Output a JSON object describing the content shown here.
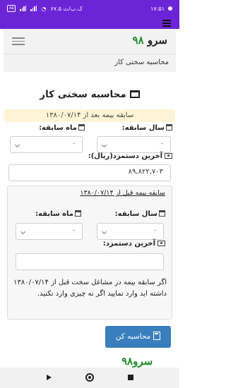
{
  "status_bar": {
    "time": "۱۷:۵۱",
    "speed": "۶۷.۵ ک.ب/ث",
    "battery": "۸۵"
  },
  "brand": {
    "name_prefix": "سرو",
    "name_number": "۹۸"
  },
  "breadcrumb": "محاسبه سختی کار",
  "page_title": "محاسبه سختی کار",
  "notice": "سابقه بیمه بعد از ۱۳۸۰/۰۷/۱۴",
  "after_section": {
    "year_label": "سال سابقه:",
    "month_label": "ماه سابقه:",
    "year_value": "۰",
    "month_value": "۰",
    "salary_label": "آخرین دستمزد(ریال):",
    "salary_value": "۸۹,۸۲۲,۷۰۳"
  },
  "before_section": {
    "header": "سابقه بیمه قبل از ۱۳۸۰/۰۷/۱۴",
    "year_label": "سال سابقه:",
    "month_label": "ماه سابقه:",
    "year_value": "۰",
    "month_value": "۰",
    "salary_label": "آخرین دستمزد:",
    "salary_value": "",
    "note": "اگر سابقه بیمه در مشاغل سخت قبل از ۱۳۸۰/۰۷/۱۴ داشته اید وارد نمایید اگر نه چیزی وارد نکنید."
  },
  "calculate_button": "محاسبه کن",
  "watermark": "سرو۹۸",
  "colors": {
    "status_bar": "#6c25d6",
    "brand_green": "#1f8b2a",
    "button": "#3a7fbd",
    "notice_bg": "#fff5d6"
  }
}
